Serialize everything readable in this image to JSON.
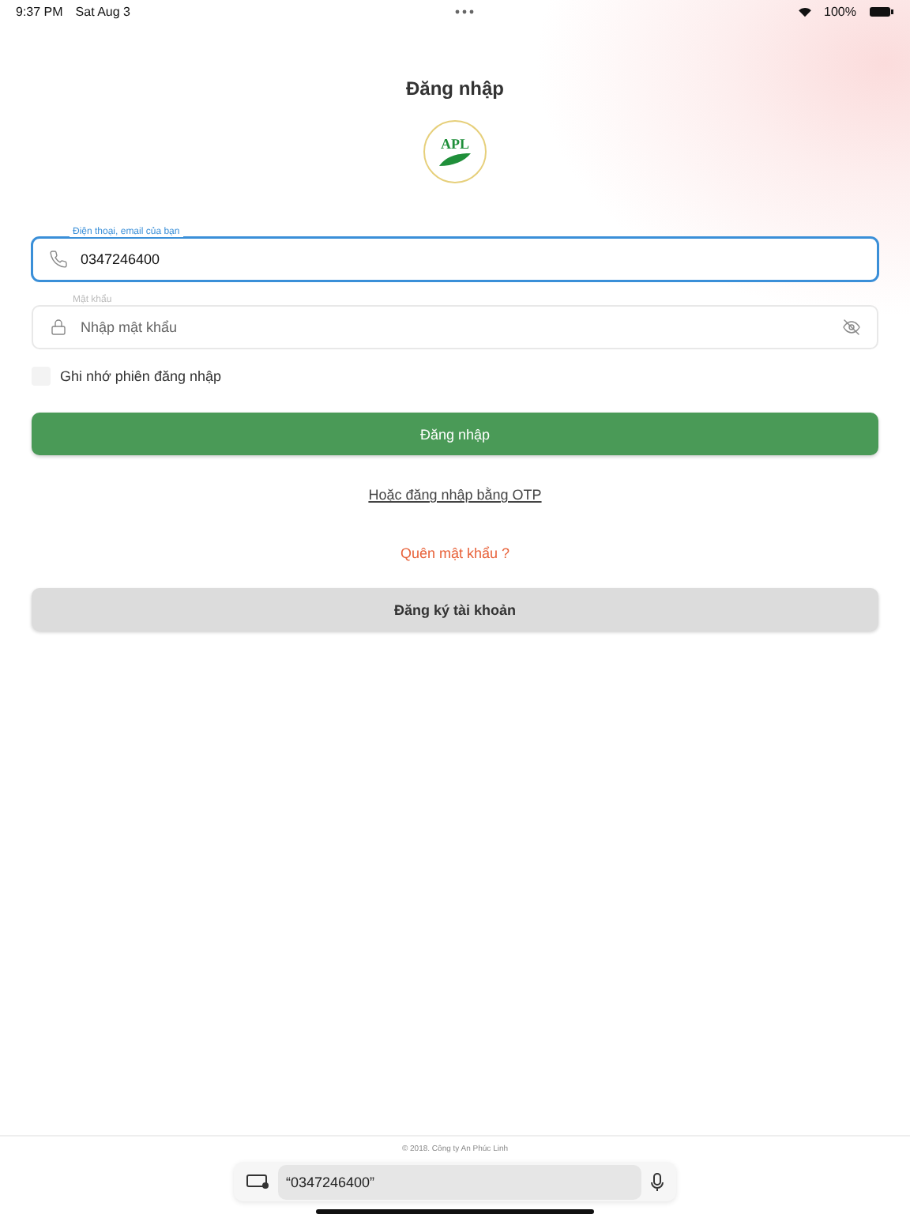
{
  "status_bar": {
    "time": "9:37 PM",
    "date": "Sat Aug 3",
    "battery": "100%"
  },
  "title": "Đăng nhập",
  "logo": {
    "text": "APL"
  },
  "phone_field": {
    "label": "Điện thoại, email của bạn",
    "value": "0347246400",
    "focused": true
  },
  "password_field": {
    "label": "Mật khẩu",
    "placeholder": "Nhập mật khẩu",
    "focused": false
  },
  "remember": {
    "label": "Ghi nhớ phiên đăng nhập",
    "checked": false
  },
  "login_button": "Đăng nhập",
  "otp_link": "Hoặc đăng nhập bằng OTP",
  "forgot_link": "Quên mật khẩu ?",
  "register_button": "Đăng ký tài khoản",
  "footer": "© 2018. Công ty An Phúc Linh",
  "keyboard_bar": {
    "suggestion": "“0347246400”"
  }
}
